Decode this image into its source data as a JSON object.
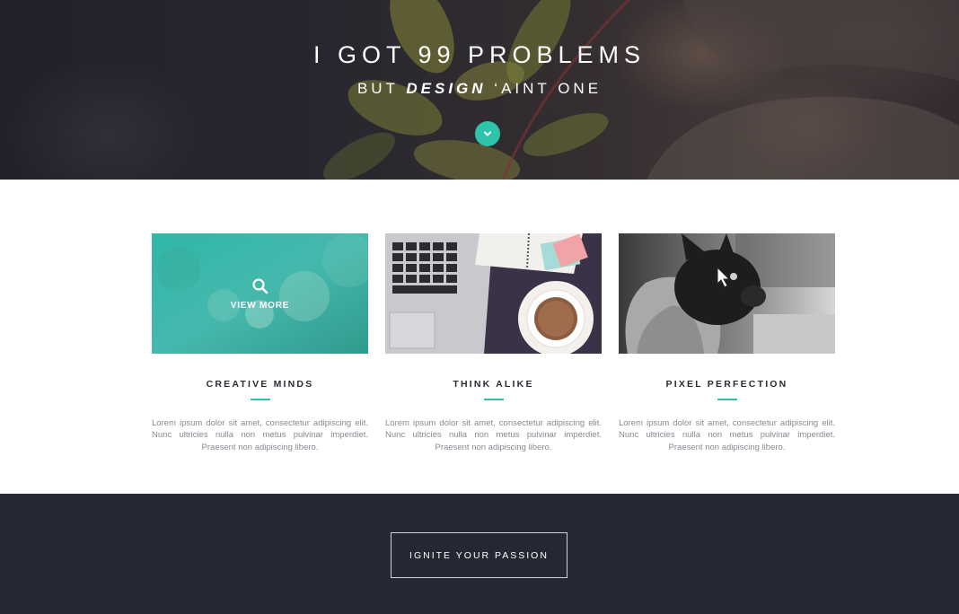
{
  "hero": {
    "title": "I GOT 99 PROBLEMS",
    "subtitle_pre": "BUT",
    "subtitle_emphasis": "DESIGN",
    "subtitle_post": "‘AINT ONE",
    "scroll_icon": "chevron-down-icon"
  },
  "features": {
    "cards": [
      {
        "title": "CREATIVE MINDS",
        "overlay_label": "VIEW MORE",
        "overlay_icon": "search-icon",
        "text": "Lorem ipsum dolor sit amet, consectetur adipiscing elit. Nunc ultricies nulla non metus pulvinar imperdiet. Praesent non adipiscing libero."
      },
      {
        "title": "THINK ALIKE",
        "text": "Lorem ipsum dolor sit amet, consectetur adipiscing elit. Nunc ultricies nulla non metus pulvinar imperdiet. Praesent non adipiscing libero."
      },
      {
        "title": "PIXEL PERFECTION",
        "text": "Lorem ipsum dolor sit amet, consectetur adipiscing elit. Nunc ultricies nulla non metus pulvinar imperdiet. Praesent non adipiscing libero."
      }
    ]
  },
  "footer": {
    "cta_label": "IGNITE YOUR PASSION"
  },
  "colors": {
    "accent": "#2ec4a9",
    "footer_bg": "#252833",
    "heading_text": "#2b2b33",
    "body_text": "#888a92"
  }
}
